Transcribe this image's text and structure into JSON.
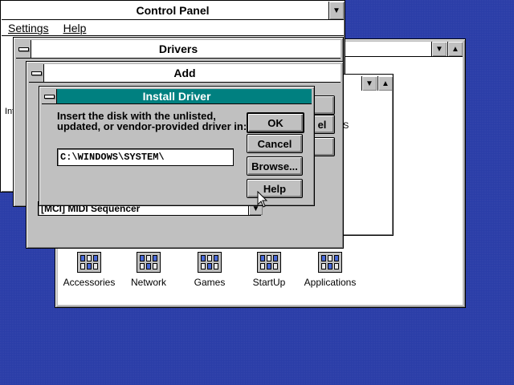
{
  "control_panel": {
    "title": "Control Panel",
    "menu": [
      "Settings",
      "Help"
    ],
    "partial_text": "Int"
  },
  "program_manager": {
    "icons": [
      {
        "label": "Accessories",
        "icon": "accessories-group-icon"
      },
      {
        "label": "Network",
        "icon": "network-group-icon"
      },
      {
        "label": "Games",
        "icon": "games-group-icon"
      },
      {
        "label": "StartUp",
        "icon": "startup-group-icon"
      },
      {
        "label": "Applications",
        "icon": "applications-group-icon"
      }
    ]
  },
  "drivers": {
    "title": "Drivers",
    "partial_btn": "el",
    "partial_side": "S"
  },
  "add": {
    "title": "Add",
    "driver_list_selected": "[MCI] MIDI Sequencer"
  },
  "install_driver": {
    "title": "Install Driver",
    "prompt_line1": "Insert the disk with the unlisted,",
    "prompt_line2": "updated, or vendor-provided driver in:",
    "path_value": "C:\\WINDOWS\\SYSTEM\\",
    "buttons": {
      "ok": "OK",
      "cancel": "Cancel",
      "browse": "Browse...",
      "help": "Help"
    }
  }
}
